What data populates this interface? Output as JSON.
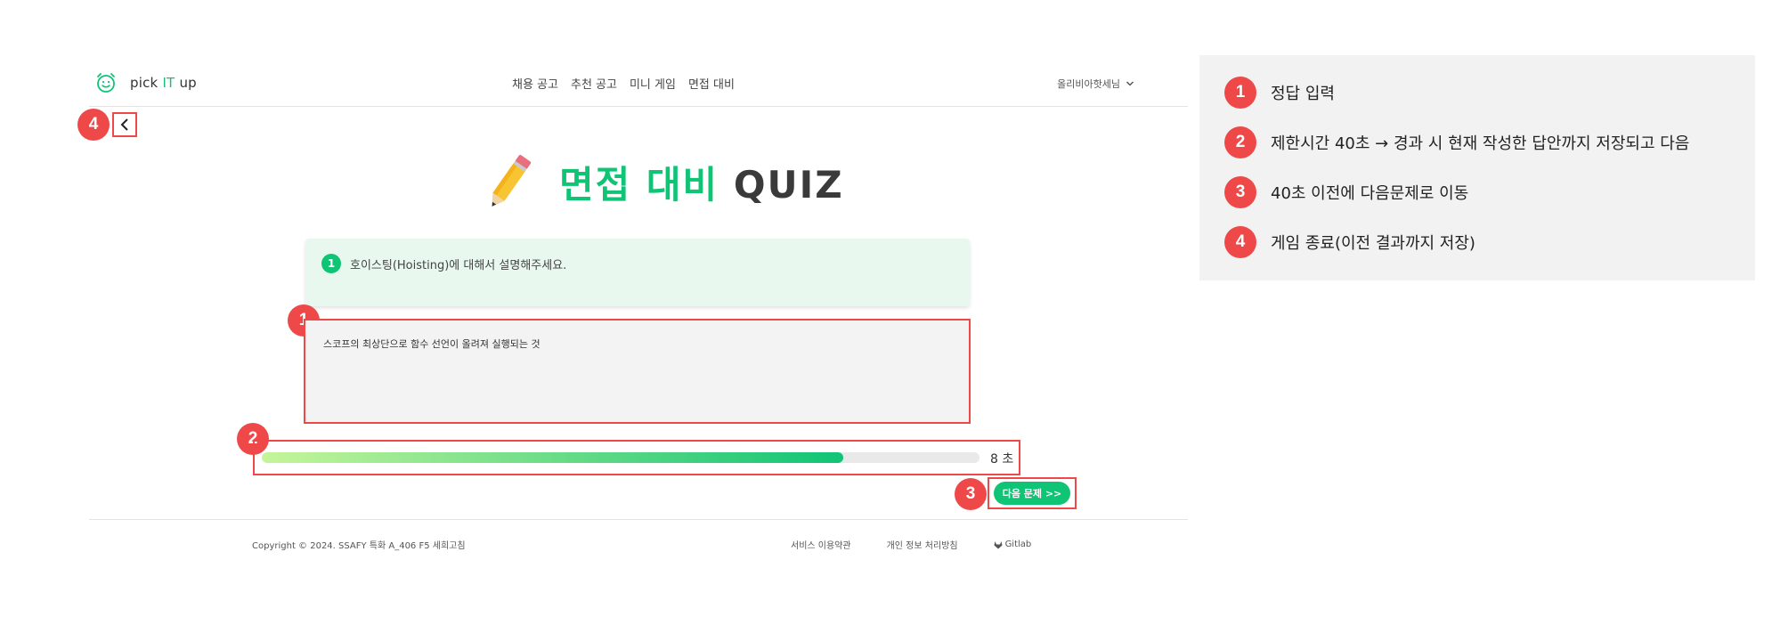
{
  "header": {
    "logo_pick": "pick",
    "logo_it": "IT",
    "logo_up": "up",
    "nav": [
      "채용 공고",
      "추천 공고",
      "미니 게임",
      "면접 대비"
    ],
    "user_name": "올리비아핫세님"
  },
  "page": {
    "title_green": "면접 대비",
    "title_dark": "QUIZ"
  },
  "question": {
    "number": "1",
    "text": "호이스팅(Hoisting)에 대해서 설명해주세요."
  },
  "answer": {
    "value": "스코프의 최상단으로 함수 선언이 올려져 실행되는 것"
  },
  "timer": {
    "label": "8 초",
    "progress": 0.81
  },
  "next_button": {
    "label": "다음 문제 >>"
  },
  "footer": {
    "copyright": "Copyright © 2024. SSAFY 특화 A_406 F5 세희고침",
    "links": [
      "서비스 이용약관",
      "개인 정보 처리방침",
      "Gitlab"
    ]
  },
  "annotations": {
    "markers": [
      "1",
      "2",
      "3",
      "4"
    ]
  },
  "legend": {
    "items": [
      {
        "num": "1",
        "text": "정답 입력"
      },
      {
        "num": "2",
        "text": "제한시간 40초 → 경과 시 현재 작성한 답안까지 저장되고 다음"
      },
      {
        "num": "3",
        "text": "40초 이전에 다음문제로 이동"
      },
      {
        "num": "4",
        "text": "게임 종료(이전 결과까지 저장)"
      }
    ]
  },
  "colors": {
    "brand_green": "#10c476",
    "annotation_red": "#ef4848",
    "question_bg": "#e8f8ee"
  }
}
